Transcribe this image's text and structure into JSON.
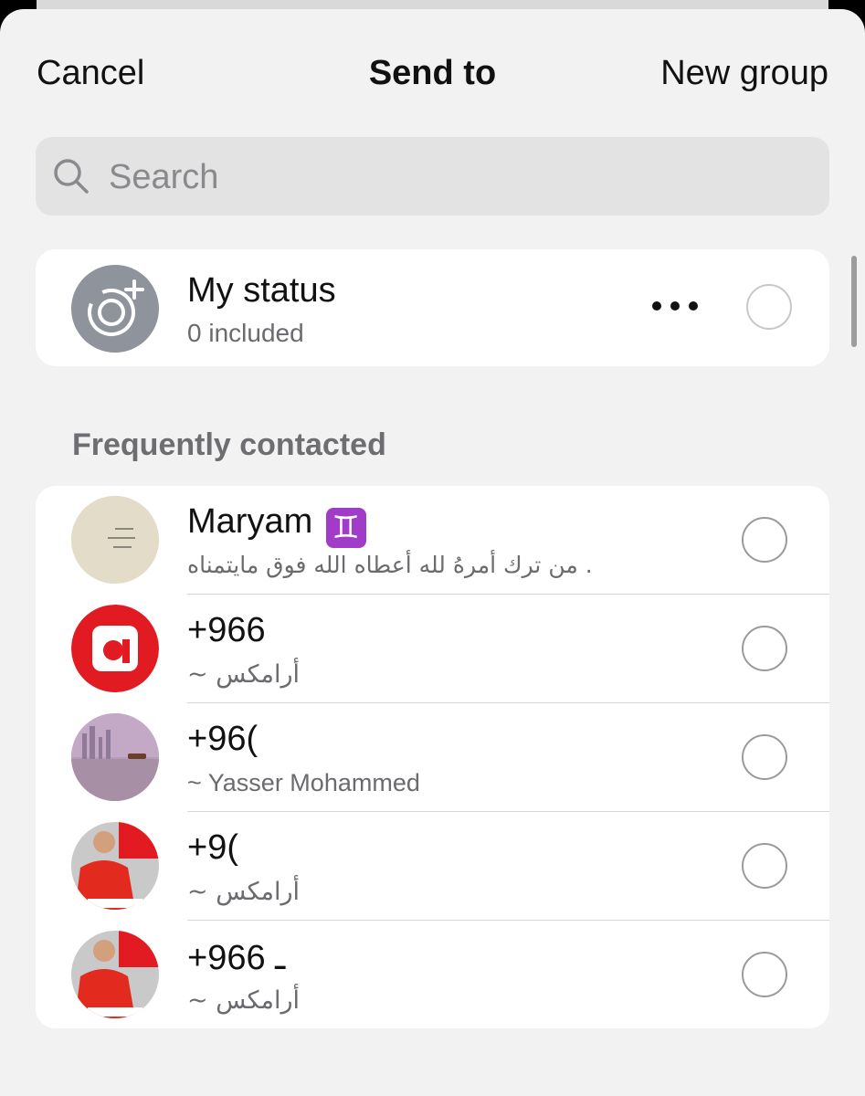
{
  "nav": {
    "cancel_label": "Cancel",
    "title": "Send to",
    "new_group_label": "New group"
  },
  "search": {
    "placeholder": "Search",
    "value": ""
  },
  "my_status": {
    "name": "My status",
    "subtitle": "0 included",
    "icon": "status-add-icon",
    "selected": false
  },
  "frequently_contacted": {
    "header": "Frequently contacted",
    "contacts": [
      {
        "name": "Maryam",
        "emoji": "♊",
        "subtitle": "من ترك أمرهُ لله أعطاه الله فوق مايتمناه .",
        "avatar": "paper-note-photo",
        "selected": false
      },
      {
        "name": "+966",
        "subtitle": "~ أرامكس",
        "avatar": "aramex-logo",
        "selected": false
      },
      {
        "name": "+96(",
        "subtitle": "~ Yasser Mohammed",
        "avatar": "city-skyline-photo",
        "selected": false
      },
      {
        "name": "+9(",
        "subtitle": "~ أرامكس",
        "avatar": "aramex-staff-photo",
        "selected": false
      },
      {
        "name": "+966 ـ",
        "subtitle": "~ أرامكس",
        "avatar": "aramex-staff-photo",
        "selected": false
      }
    ]
  },
  "colors": {
    "sheet_bg": "#f2f2f2",
    "card_bg": "#ffffff",
    "search_bg": "#e3e3e4",
    "aramex_red": "#e21b23",
    "status_avatar_bg": "#8e939c"
  }
}
